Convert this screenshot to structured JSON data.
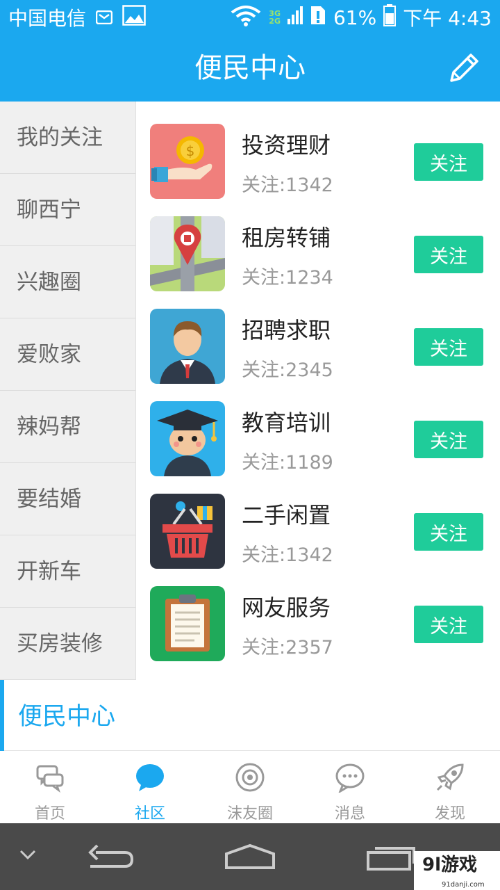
{
  "status_bar": {
    "carrier": "中国电信",
    "battery": "61%",
    "time": "下午 4:43",
    "net_top": "3G",
    "net_bottom": "2G"
  },
  "header": {
    "title": "便民中心",
    "edit_icon": "pencil-icon"
  },
  "sidebar": {
    "items": [
      {
        "label": "我的关注"
      },
      {
        "label": "聊西宁"
      },
      {
        "label": "兴趣圈"
      },
      {
        "label": "爱败家"
      },
      {
        "label": "辣妈帮"
      },
      {
        "label": "要结婚"
      },
      {
        "label": "开新车"
      },
      {
        "label": "买房装修"
      }
    ],
    "active": {
      "label": "便民中心"
    }
  },
  "list": {
    "follow_label": "关注",
    "items": [
      {
        "name": "投资理财",
        "count": "关注:1342",
        "icon": "coin-hand-icon"
      },
      {
        "name": "租房转铺",
        "count": "关注:1234",
        "icon": "map-pin-icon"
      },
      {
        "name": "招聘求职",
        "count": "关注:2345",
        "icon": "businessman-icon"
      },
      {
        "name": "教育培训",
        "count": "关注:1189",
        "icon": "graduate-icon"
      },
      {
        "name": "二手闲置",
        "count": "关注:1342",
        "icon": "basket-icon"
      },
      {
        "name": "网友服务",
        "count": "关注:2357",
        "icon": "clipboard-icon"
      }
    ]
  },
  "tabbar": {
    "items": [
      {
        "label": "首页",
        "icon": "chat-bubbles-icon"
      },
      {
        "label": "社区",
        "icon": "speech-bubble-icon"
      },
      {
        "label": "沫友圈",
        "icon": "eye-circle-icon"
      },
      {
        "label": "消息",
        "icon": "message-dots-icon"
      },
      {
        "label": "发现",
        "icon": "rocket-icon"
      }
    ]
  },
  "watermark": {
    "text": "9l游戏",
    "sub": "91danji.com"
  },
  "colors": {
    "primary": "#1ba8ef",
    "follow_button": "#1fcc9a",
    "sidebar_bg": "#f0f0f0",
    "navbar": "#4a4a4a"
  }
}
